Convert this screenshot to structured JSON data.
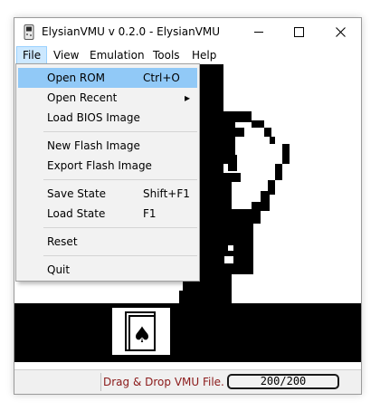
{
  "window": {
    "title": "ElysianVMU v 0.2.0 - ElysianVMU",
    "minimize_glyph": "—",
    "maximize_glyph": "☐",
    "close_glyph": "✕"
  },
  "menubar": {
    "items": [
      "File",
      "View",
      "Emulation",
      "Tools",
      "Help"
    ],
    "active": "File"
  },
  "file_menu": {
    "items": [
      {
        "label": "Open ROM",
        "shortcut": "Ctrl+O",
        "highlighted": true
      },
      {
        "label": "Open Recent",
        "shortcut": "",
        "submenu": true
      },
      {
        "label": "Load BIOS Image",
        "shortcut": ""
      },
      {
        "label": "New Flash Image",
        "shortcut": ""
      },
      {
        "label": "Export Flash Image",
        "shortcut": ""
      },
      {
        "label": "Save State",
        "shortcut": "Shift+F1"
      },
      {
        "label": "Load State",
        "shortcut": "F1"
      },
      {
        "label": "Reset",
        "shortcut": ""
      },
      {
        "label": "Quit",
        "shortcut": ""
      }
    ],
    "submenu_arrow": "▸"
  },
  "statusbar": {
    "message": "Drag & Drop VMU File.",
    "counter": "200/200",
    "message_color": "#8b1a1a"
  },
  "screen": {
    "card_suit": "♠"
  },
  "colors": {
    "menu_highlight": "#91c9f7",
    "menubar_active": "#cce8ff"
  }
}
